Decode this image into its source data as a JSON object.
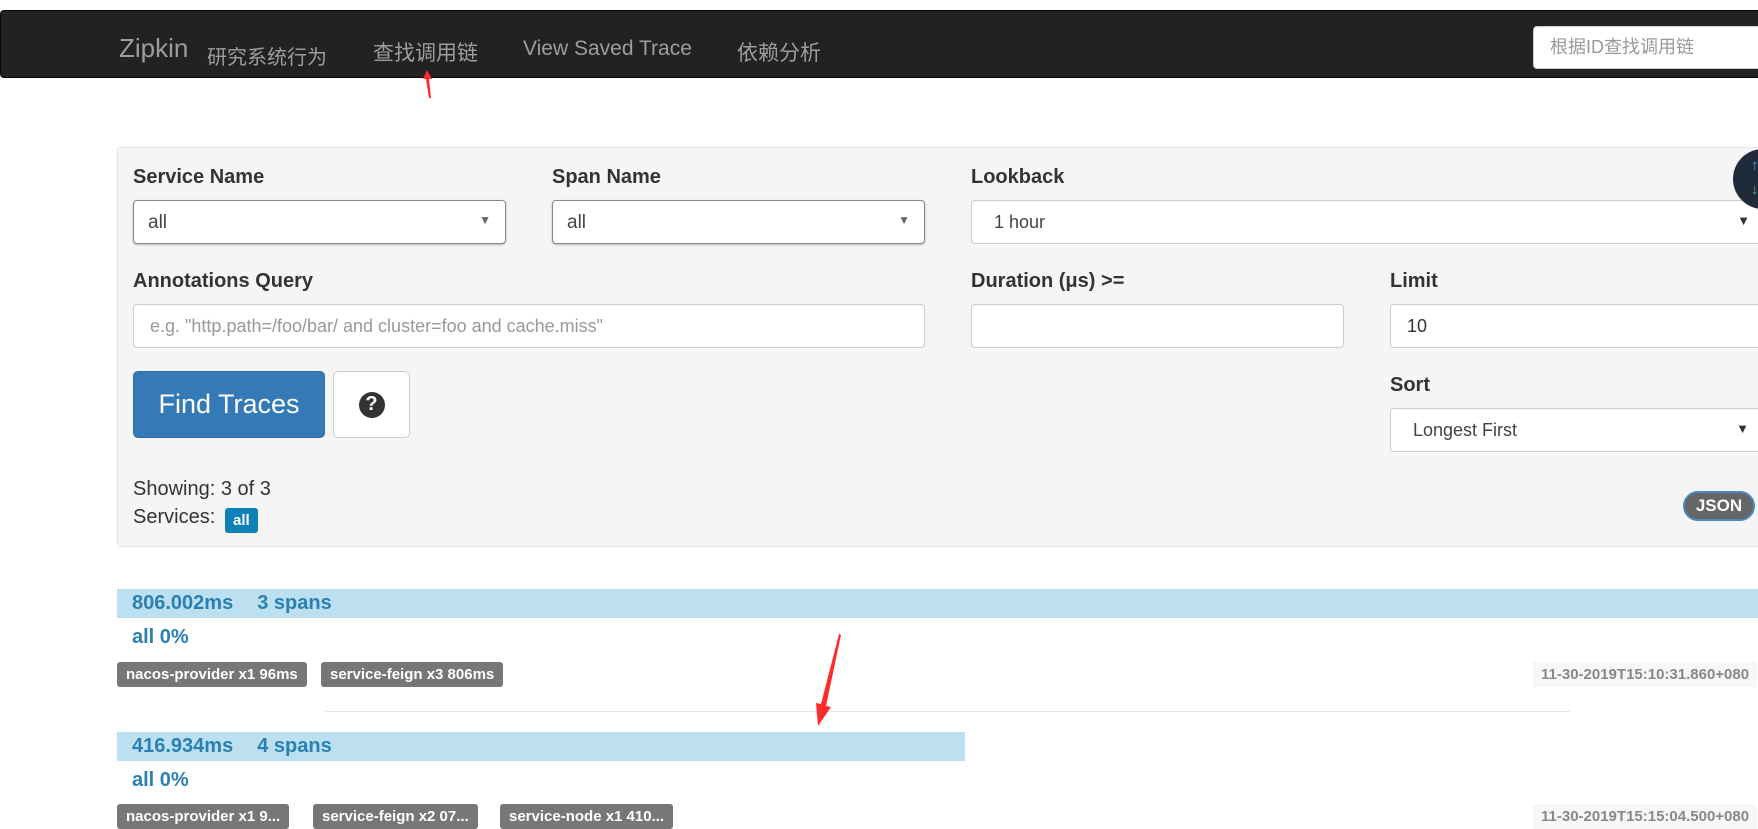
{
  "navbar": {
    "brand": "Zipkin",
    "brand_sub": "研究系统行为",
    "links": [
      "查找调用链",
      "View Saved Trace",
      "依赖分析"
    ],
    "search_placeholder": "根据ID查找调用链"
  },
  "search": {
    "service_name": {
      "label": "Service Name",
      "value": "all"
    },
    "span_name": {
      "label": "Span Name",
      "value": "all"
    },
    "lookback": {
      "label": "Lookback",
      "value": "1 hour"
    },
    "annotations_query": {
      "label": "Annotations Query",
      "placeholder": "e.g. \"http.path=/foo/bar/ and cluster=foo and cache.miss\""
    },
    "duration": {
      "label": "Duration (μs) >=",
      "value": ""
    },
    "limit": {
      "label": "Limit",
      "value": "10"
    },
    "sort": {
      "label": "Sort",
      "value": "Longest First"
    },
    "find_button": "Find Traces",
    "help_glyph": "?",
    "showing": "Showing: 3 of 3",
    "services_label": "Services:",
    "services_badge": "all",
    "json_button": "JSON"
  },
  "traces": [
    {
      "duration": "806.002ms",
      "spans": "3 spans",
      "summary": "all 0%",
      "bar_fraction": 1.0,
      "badges": [
        "nacos-provider x1 96ms",
        "service-feign x3 806ms"
      ],
      "timestamp": "11-30-2019T15:10:31.860+080"
    },
    {
      "duration": "416.934ms",
      "spans": "4 spans",
      "summary": "all 0%",
      "bar_fraction": 0.517,
      "badges": [
        "nacos-provider x1 9...",
        "service-feign x2 07...",
        "service-node x1 410..."
      ],
      "timestamp": "11-30-2019T15:15:04.500+080"
    }
  ],
  "colors": {
    "navbar_bg": "#222222",
    "primary": "#337ab7",
    "trace_bar": "#bde0f0",
    "trace_text": "#2a7fb3",
    "badge_blue": "#0f81b5",
    "badge_gray": "#777777",
    "annotation_arrow": "#ff2a2a"
  }
}
